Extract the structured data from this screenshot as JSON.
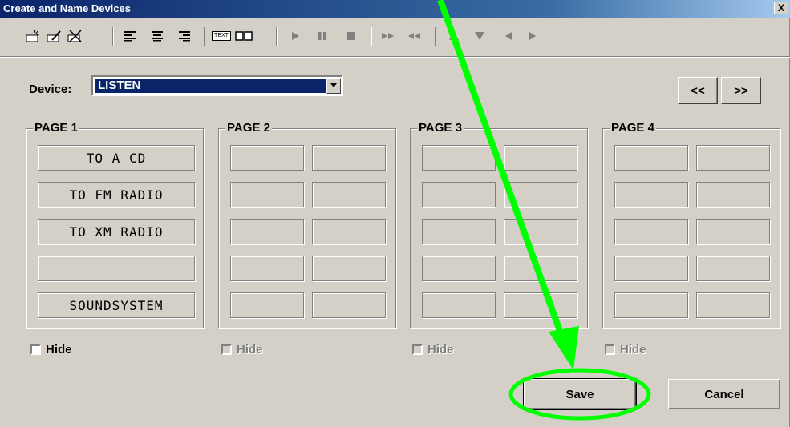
{
  "window": {
    "title": "Create and Name Devices",
    "close_label": "X"
  },
  "toolbar": {
    "icons": [
      "new-button-icon",
      "edit-button-icon",
      "delete-button-icon",
      "align-left-icon",
      "align-center-icon",
      "align-right-icon",
      "text-button-icon",
      "icon-button-icon",
      "play-icon",
      "pause-icon",
      "stop-icon",
      "fast-forward-icon",
      "rewind-icon",
      "up-arrow-icon",
      "down-arrow-icon",
      "left-arrow-icon",
      "right-arrow-icon"
    ],
    "text_icon_label": "TEXT"
  },
  "device": {
    "label": "Device:",
    "value": "LISTEN"
  },
  "nav": {
    "prev_label": "<<",
    "next_label": ">>"
  },
  "pages": [
    {
      "title": "PAGE 1",
      "hide_label": "Hide",
      "hide_enabled": true,
      "slots": [
        "TO A CD",
        "TO FM RADIO",
        "TO XM RADIO",
        "",
        "SOUNDSYSTEM"
      ]
    },
    {
      "title": "PAGE 2",
      "hide_label": "Hide",
      "hide_enabled": false,
      "slots": [
        "",
        "",
        "",
        "",
        "",
        "",
        "",
        "",
        "",
        ""
      ]
    },
    {
      "title": "PAGE 3",
      "hide_label": "Hide",
      "hide_enabled": false,
      "slots": [
        "",
        "",
        "",
        "",
        "",
        "",
        "",
        "",
        "",
        ""
      ]
    },
    {
      "title": "PAGE 4",
      "hide_label": "Hide",
      "hide_enabled": false,
      "slots": [
        "",
        "",
        "",
        "",
        "",
        "",
        "",
        "",
        "",
        ""
      ]
    }
  ],
  "buttons": {
    "save_label": "Save",
    "cancel_label": "Cancel"
  },
  "annotation": {
    "color": "#00ff00"
  }
}
